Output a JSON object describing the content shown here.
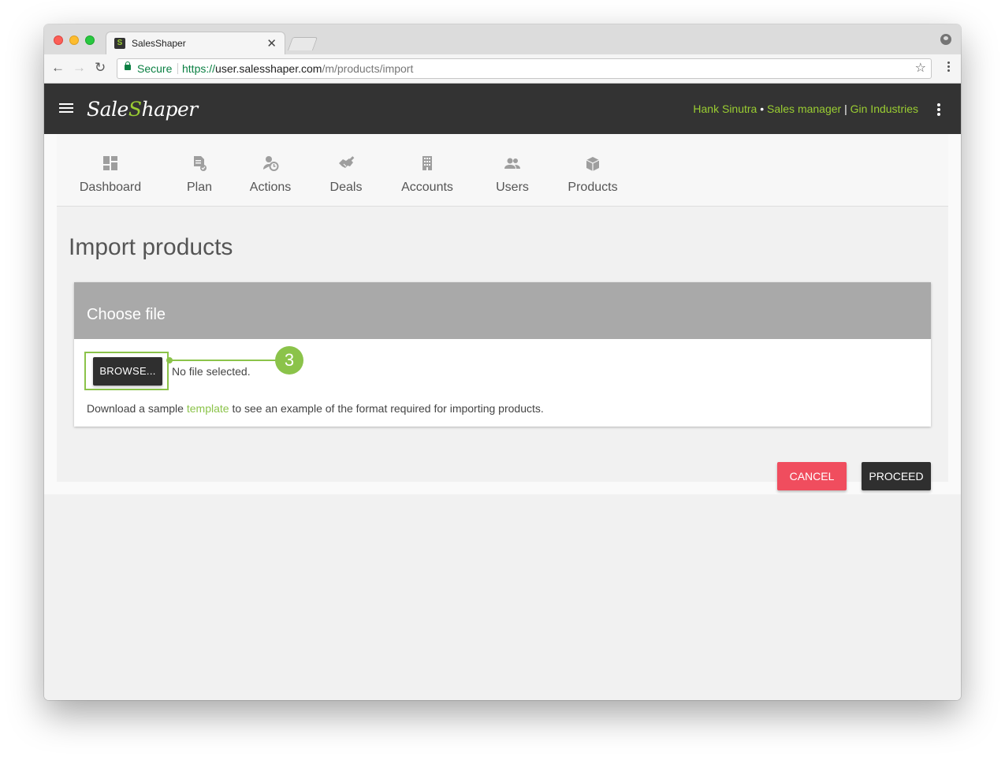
{
  "browser": {
    "tab_title": "SalesShaper",
    "tab_favicon": "S",
    "secure_label": "Secure",
    "url_scheme": "https://",
    "url_host": "user.salesshaper.com",
    "url_path": "/m/products/import"
  },
  "header": {
    "logo_prefix": "Sale",
    "logo_bolt": "S",
    "logo_suffix": "haper",
    "user_name": "Hank Sinutra",
    "bullet": " • ",
    "role": "Sales manager",
    "pipe": " | ",
    "company": "Gin Industries"
  },
  "nav": {
    "items": [
      {
        "label": "Dashboard",
        "icon": "dashboard-icon"
      },
      {
        "label": "Plan",
        "icon": "plan-icon"
      },
      {
        "label": "Actions",
        "icon": "actions-icon"
      },
      {
        "label": "Deals",
        "icon": "handshake-icon"
      },
      {
        "label": "Accounts",
        "icon": "building-icon"
      },
      {
        "label": "Users",
        "icon": "users-icon"
      },
      {
        "label": "Products",
        "icon": "box-icon"
      }
    ]
  },
  "page": {
    "title": "Import products",
    "card_title": "Choose file",
    "browse_label": "BROWSE...",
    "file_status": "No file selected.",
    "callout_number": "3",
    "help_prefix": "Download a sample ",
    "help_link": "template",
    "help_suffix": " to see an example of the format required for importing products.",
    "cancel_label": "CANCEL",
    "proceed_label": "PROCEED"
  },
  "colors": {
    "accent": "#8bc34a",
    "header_bg": "#333333",
    "cancel": "#f04d5e",
    "primary_button": "#2f2f2f",
    "card_header": "#a9a9a9"
  }
}
